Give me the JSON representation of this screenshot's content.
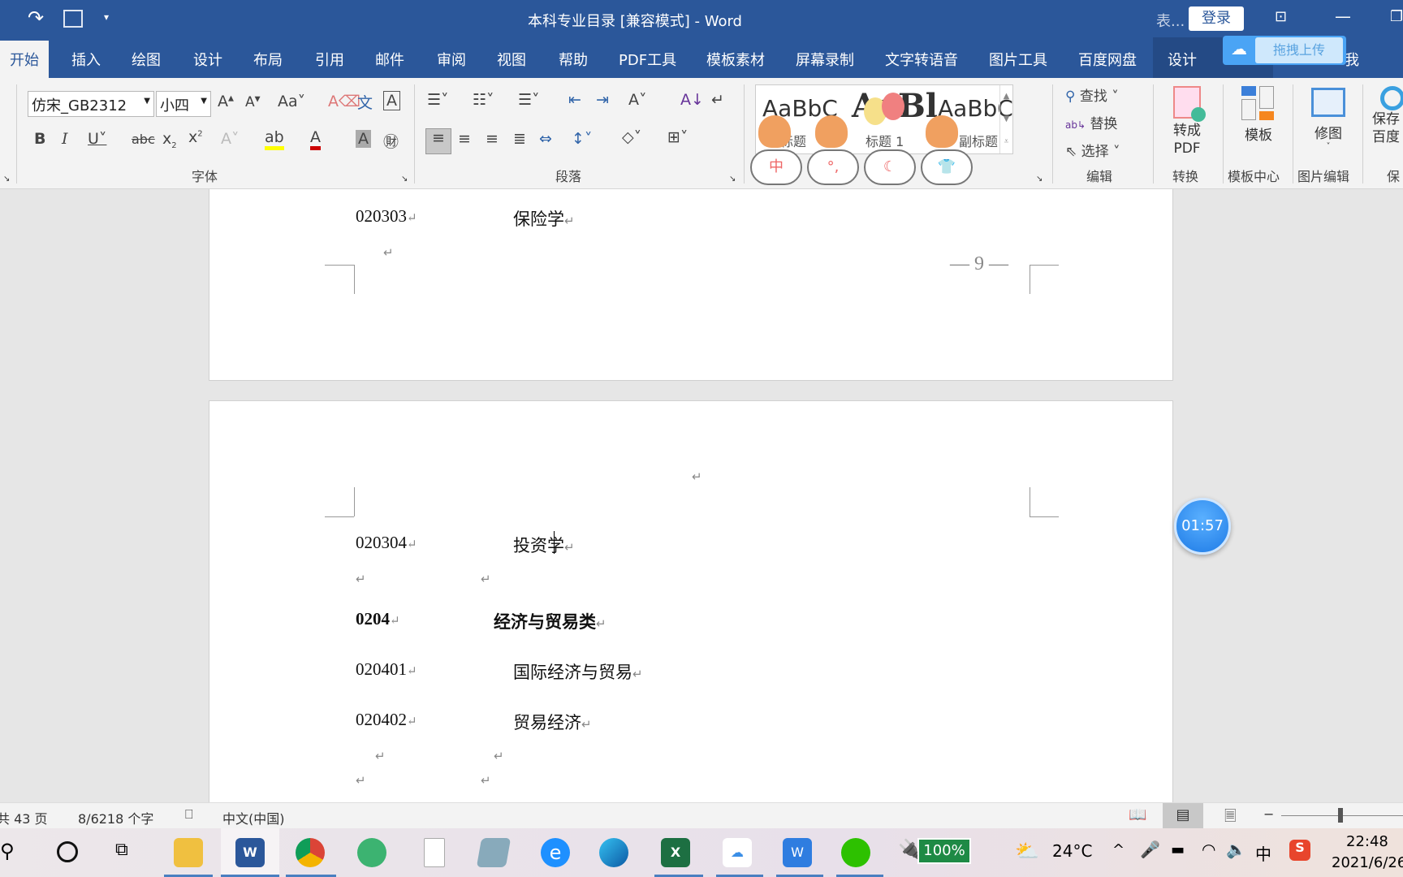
{
  "titlebar": {
    "title": "本科专业目录 [兼容模式]  -  Word",
    "search_trunc": "表...",
    "login": "登录",
    "upload_label": "拖拽上传"
  },
  "tabs": [
    "开始",
    "插入",
    "绘图",
    "设计",
    "布局",
    "引用",
    "邮件",
    "审阅",
    "视图",
    "帮助",
    "PDF工具",
    "模板素材",
    "屏幕录制",
    "文字转语音",
    "图片工具",
    "百度网盘",
    "设计"
  ],
  "tab_tail": "我",
  "ribbon": {
    "font": {
      "name": "仿宋_GB2312",
      "size": "小四",
      "group": "字体"
    },
    "paragraph": {
      "group": "段落"
    },
    "styles": {
      "s1": "AaBbC",
      "s2": "AaBl",
      "s3": "AaBbC",
      "l1": "标题",
      "l2": "标题 1",
      "l3": "副标题"
    },
    "editing": {
      "find": "查找",
      "replace": "替换",
      "select": "选择",
      "group": "编辑"
    },
    "convert": {
      "label": "转成\nPDF",
      "group": "转换"
    },
    "template": {
      "label": "模板",
      "group": "模板中心"
    },
    "image": {
      "label": "修图",
      "group": "图片编辑"
    },
    "save": {
      "label": "保存\n百度",
      "group": "保"
    }
  },
  "document": {
    "page1": {
      "rows": [
        {
          "code": "020303",
          "name": "保险学"
        }
      ],
      "page_number": "9"
    },
    "page2": {
      "rows": [
        {
          "code": "020304",
          "name": "投资学",
          "bold": false
        },
        {
          "code": "0204",
          "name": "经济与贸易类",
          "bold": true
        },
        {
          "code": "020401",
          "name": "国际经济与贸易",
          "bold": false
        },
        {
          "code": "020402",
          "name": "贸易经济",
          "bold": false
        }
      ]
    },
    "para_mark": "↵"
  },
  "timer": "01:57",
  "status": {
    "pages": "共 43 页",
    "words": "8/6218 个字",
    "language": "中文(中国)"
  },
  "taskbar": {
    "battery": "100%",
    "temp": "24°C",
    "ime": "中",
    "time": "22:48",
    "date": "2021/6/26"
  },
  "colors": {
    "accent": "#2b579a",
    "battery": "#1e8a45"
  }
}
